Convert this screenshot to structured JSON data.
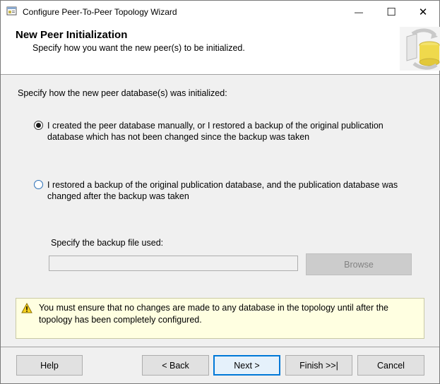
{
  "window": {
    "title": "Configure Peer-To-Peer Topology Wizard",
    "minimize_glyph": "—",
    "maximize_glyph": "☐",
    "close_glyph": "✕"
  },
  "header": {
    "title": "New Peer Initialization",
    "subtitle": "Specify how you want the new peer(s) to be initialized."
  },
  "main": {
    "prompt": "Specify how the new peer database(s) was initialized:",
    "options": [
      {
        "label": "I created the peer database manually, or I restored a backup of the original publication database which has not been changed since the backup was taken",
        "selected": true
      },
      {
        "label": "I restored a backup of the original publication database, and the publication database was changed after the backup was taken",
        "selected": false
      }
    ],
    "backup": {
      "label": "Specify the backup file used:",
      "value": "",
      "browse_label": "Browse"
    },
    "warning": "You must ensure that no changes are made to any database in the topology until after the topology has been completely configured."
  },
  "footer": {
    "help": "Help",
    "back": "< Back",
    "next": "Next >",
    "finish": "Finish >>|",
    "cancel": "Cancel"
  },
  "colors": {
    "accent": "#0078d7",
    "warning_bg": "#ffffe1",
    "disabled_button": "#cccccc"
  }
}
